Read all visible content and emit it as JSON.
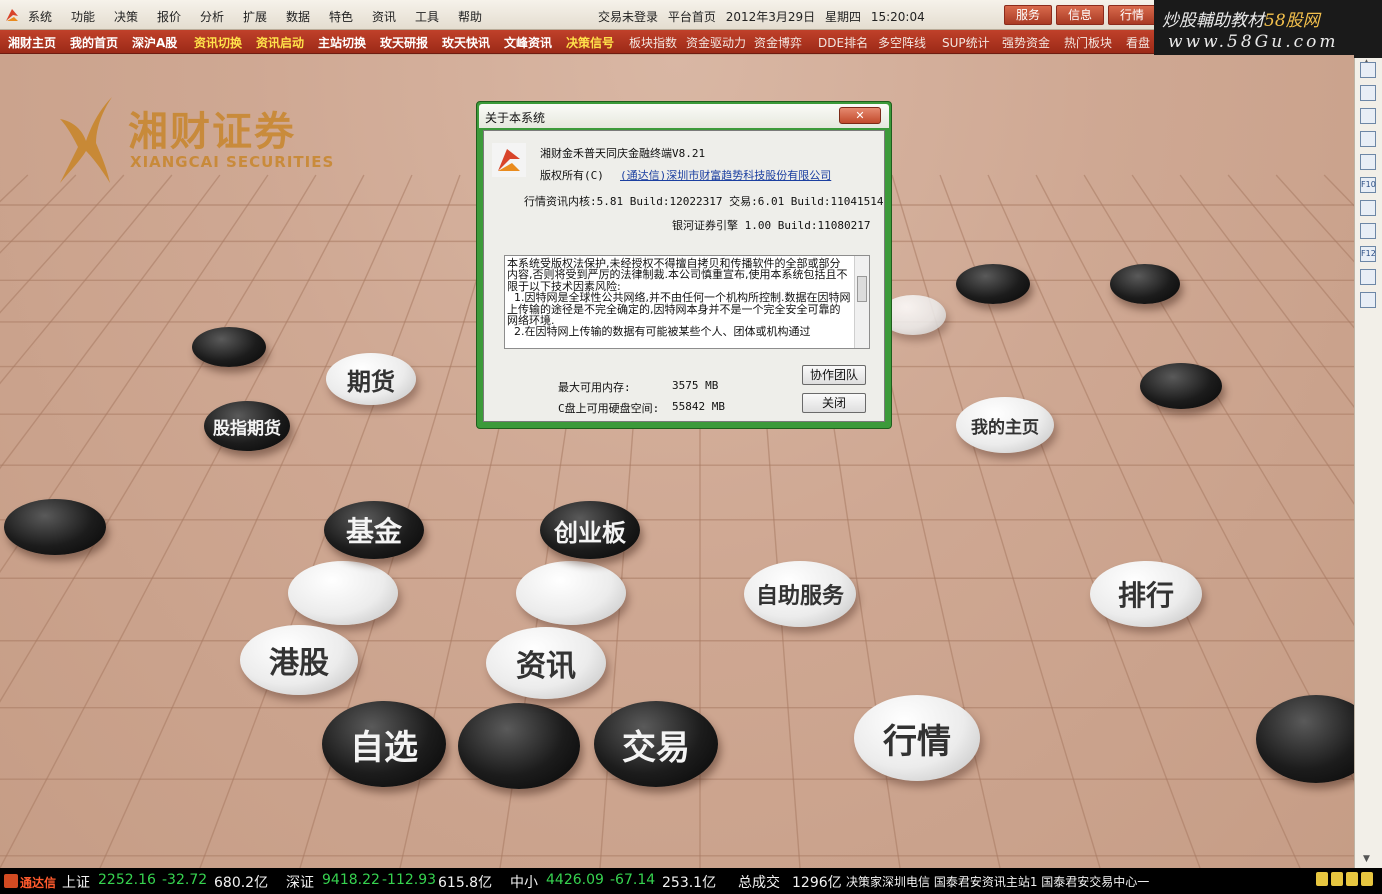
{
  "menu": {
    "items": [
      "系统",
      "功能",
      "决策",
      "报价",
      "分析",
      "扩展",
      "数据",
      "特色",
      "资讯",
      "工具",
      "帮助"
    ],
    "status": [
      "交易未登录",
      "平台首页",
      "2012年3月29日",
      "星期四",
      "15:20:04"
    ],
    "buttons": [
      "服务",
      "信息",
      "行情"
    ]
  },
  "watermark": {
    "line1_a": "炒股輔助教材",
    "line1_b": "58股网",
    "line2": "www.58Gu.com"
  },
  "toolbar": {
    "items": [
      {
        "label": "湘财主页",
        "style": "white"
      },
      {
        "label": "我的首页",
        "style": "white"
      },
      {
        "label": "深沪A股",
        "style": "white"
      },
      {
        "label": "资讯切换",
        "style": "yellow"
      },
      {
        "label": "资讯启动",
        "style": "yellow"
      },
      {
        "label": "主站切换",
        "style": "white"
      },
      {
        "label": "玫天研报",
        "style": "white"
      },
      {
        "label": "玫天快讯",
        "style": "white"
      },
      {
        "label": "文峰资讯",
        "style": "white"
      },
      {
        "label": "决策信号",
        "style": "yellow"
      },
      {
        "label": "板块指数",
        "style": "thin"
      },
      {
        "label": "资金驱动力",
        "style": "thin"
      },
      {
        "label": "资金博弈",
        "style": "thin"
      },
      {
        "label": "DDE排名",
        "style": "thin"
      },
      {
        "label": "多空阵线",
        "style": "thin"
      },
      {
        "label": "SUP统计",
        "style": "thin"
      },
      {
        "label": "强势资金",
        "style": "thin"
      },
      {
        "label": "热门板块",
        "style": "thin"
      },
      {
        "label": "看盘",
        "style": "thin"
      }
    ]
  },
  "sidebar": {
    "icons": [
      "quote-icon",
      "table-icon",
      "chart-line-icon",
      "candlestick-icon",
      "list-icon",
      "f10-icon",
      "report-icon",
      "news-icon",
      "f12-icon",
      "info-icon",
      "search-icon"
    ],
    "icon_labels": [
      "",
      "",
      "",
      "",
      "",
      "F10",
      "",
      "",
      "F12",
      "",
      ""
    ]
  },
  "brand": {
    "cn": "湘财证券",
    "en": "XIANGCAI SECURITIES"
  },
  "stones": [
    {
      "id": "stone-futures",
      "label": "期货",
      "color": "white"
    },
    {
      "id": "stone-index-futures",
      "label": "股指期货",
      "color": "black"
    },
    {
      "id": "stone-homepage",
      "label": "我的主页",
      "color": "white"
    },
    {
      "id": "stone-fund",
      "label": "基金",
      "color": "black"
    },
    {
      "id": "stone-gem",
      "label": "创业板",
      "color": "black"
    },
    {
      "id": "stone-self-service",
      "label": "自助服务",
      "color": "white"
    },
    {
      "id": "stone-ranking",
      "label": "排行",
      "color": "white"
    },
    {
      "id": "stone-hk",
      "label": "港股",
      "color": "white"
    },
    {
      "id": "stone-news",
      "label": "资讯",
      "color": "white"
    },
    {
      "id": "stone-watchlist",
      "label": "自选",
      "color": "black"
    },
    {
      "id": "stone-trade",
      "label": "交易",
      "color": "black"
    },
    {
      "id": "stone-quotes",
      "label": "行情",
      "color": "white"
    }
  ],
  "dialog": {
    "title": "关于本系统",
    "close_label": "✕",
    "product": "湘财金禾普天同庆金融终端V8.21",
    "copyright_prefix": "版权所有(C)",
    "copyright_link": "(通达信)深圳市财富趋势科技股份有限公司",
    "build_info": "行情资讯内核:5.81 Build:12022317 交易:6.01 Build:11041514",
    "engine_info": "银河证券引擎 1.00 Build:11080217",
    "license_text": "本系统受版权法保护,未经授权不得擅自拷贝和传播软件的全部或部分内容,否则将受到严厉的法律制裁.本公司慎重宣布,使用本系统包括且不限于以下技术因素风险:\n  1.因特网是全球性公共网络,并不由任何一个机构所控制.数据在因特网上传输的途径是不完全确定的,因特网本身并不是一个完全安全可靠的网络环境.\n  2.在因特网上传输的数据有可能被某些个人、团体或机构通过",
    "memory_label": "最大可用内存:",
    "memory_value": "3575 MB",
    "disk_label": "C盘上可用硬盘空间:",
    "disk_value": "55842 MB",
    "team_button": "协作团队",
    "close_button": "关闭"
  },
  "statusbar": {
    "brand": "通达信",
    "sh_label": "上证",
    "sh_value": "2252.16",
    "sh_change": "-32.72",
    "sh_amount": "680.2亿",
    "sz_label": "深证",
    "sz_value": "9418.22",
    "sz_change": "-112.93",
    "sz_amount": "615.8亿",
    "zx_label": "中小",
    "zx_value": "4426.09",
    "zx_change": "-67.14",
    "zx_amount": "253.1亿",
    "total_label": "总成交",
    "total_value": "1296亿",
    "news": "决策家深圳电信  国泰君安资讯主站1  国泰君安交易中心一"
  }
}
